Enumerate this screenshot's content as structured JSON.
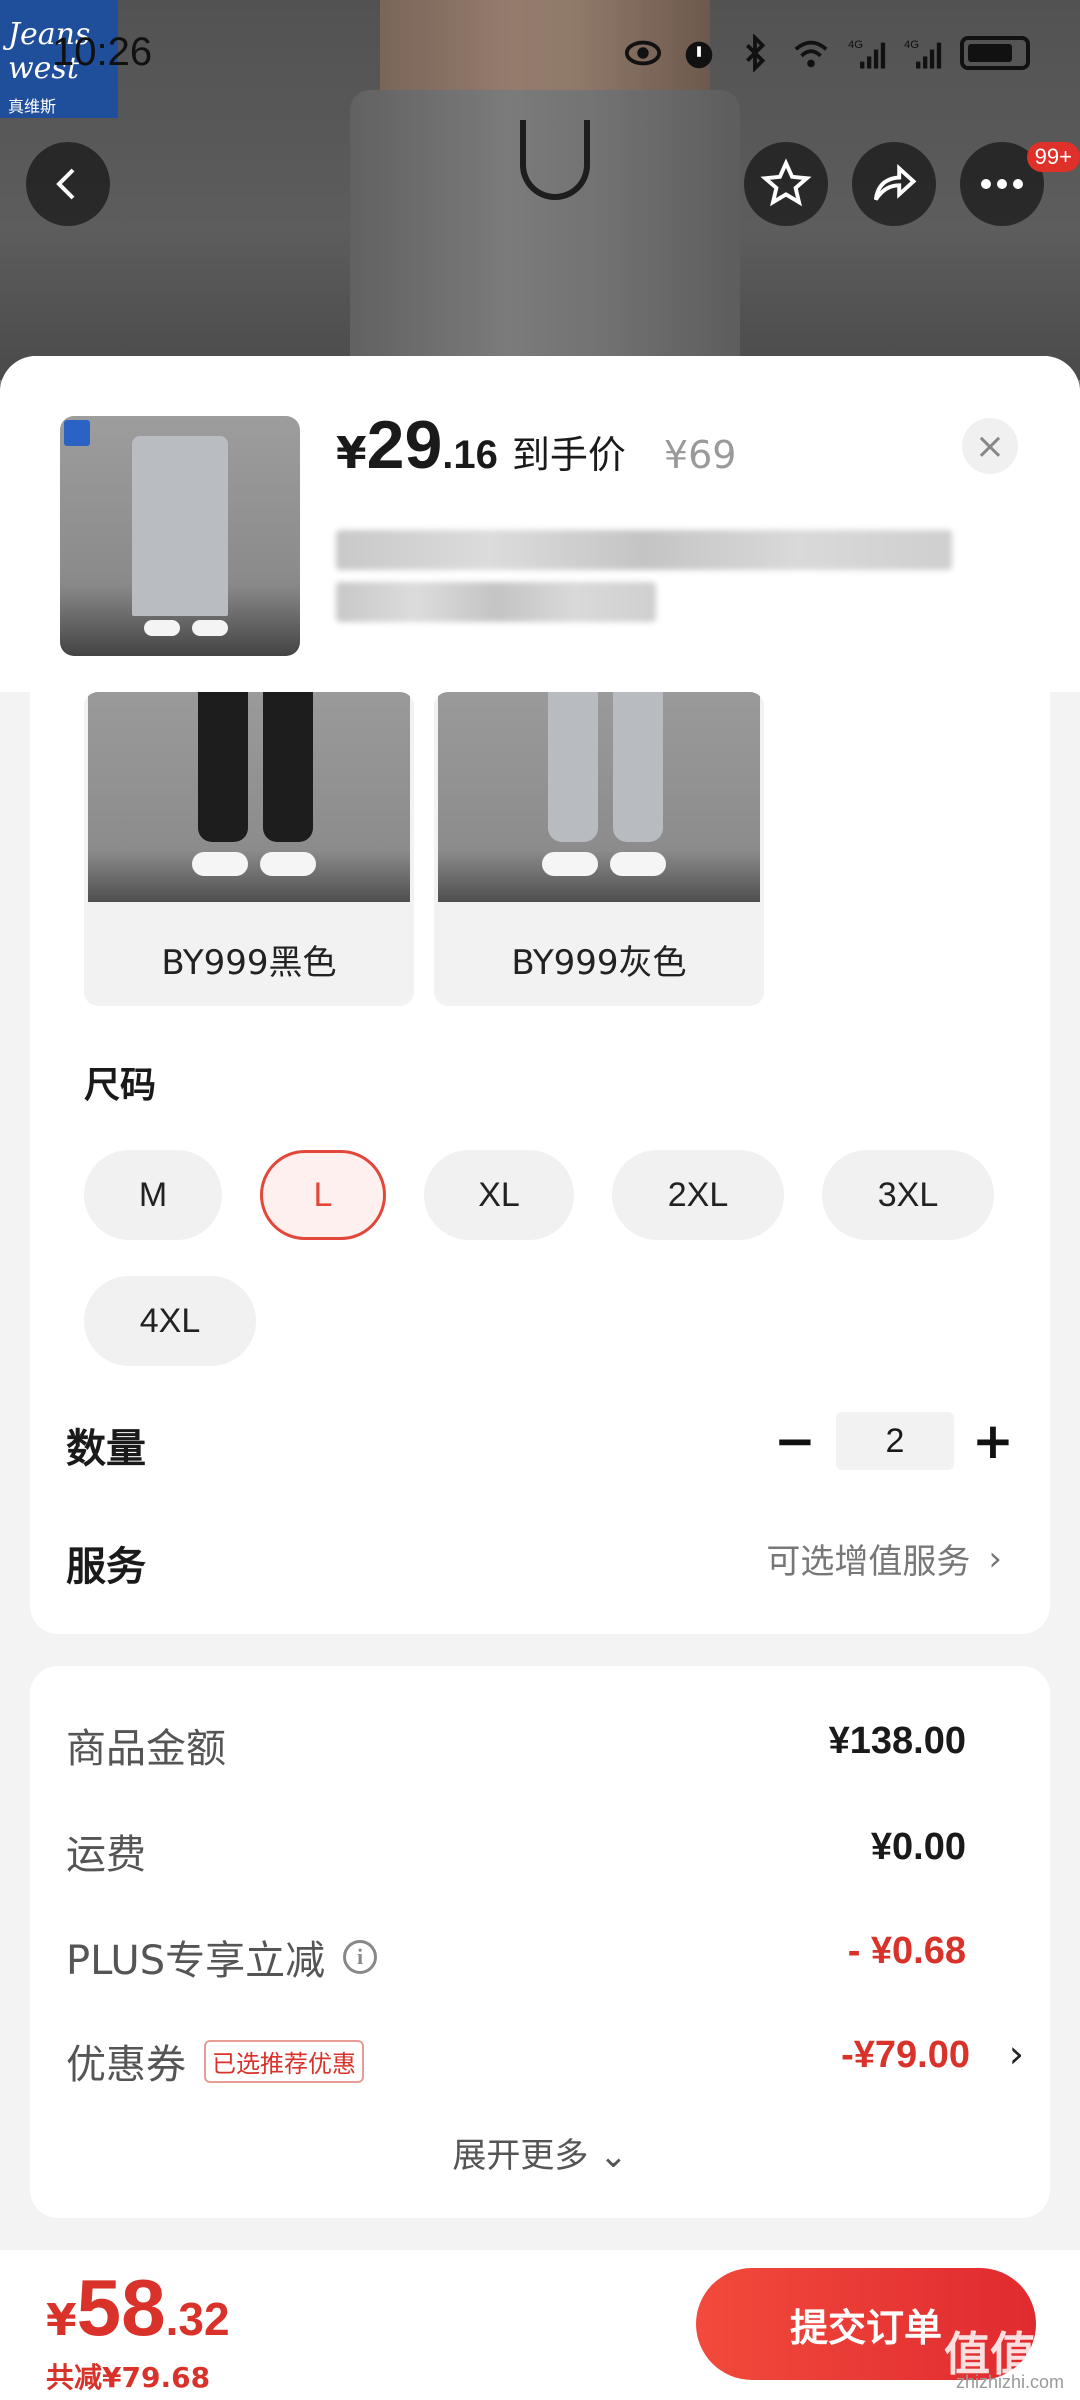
{
  "status": {
    "time": "10:26",
    "icons": [
      "eye-icon",
      "alarm-icon",
      "bluetooth-icon",
      "wifi-icon",
      "signal-4g-icon",
      "signal-4g-icon",
      "battery-icon"
    ]
  },
  "brand_logo": {
    "line1": "Jeans",
    "line2": "west",
    "cn": "真维斯"
  },
  "top_nav": {
    "notification_count": "99+"
  },
  "product": {
    "price_currency": "¥",
    "price_int": "29",
    "price_dec": ".16",
    "price_tag": "到手价",
    "original_price": "¥69",
    "close_glyph": "×"
  },
  "variants": [
    {
      "label": "BY999黑色",
      "pant_color": "#1d1d1d"
    },
    {
      "label": "BY999灰色",
      "pant_color": "#b8bcc0"
    }
  ],
  "size": {
    "title": "尺码",
    "options": [
      "M",
      "L",
      "XL",
      "2XL",
      "3XL",
      "4XL"
    ],
    "selected": "L"
  },
  "quantity": {
    "label": "数量",
    "value": "2",
    "minus": "−",
    "plus": "+"
  },
  "service": {
    "label": "服务",
    "hint": "可选增值服务",
    "chevron": "›"
  },
  "summary": {
    "goods_amount_label": "商品金额",
    "goods_amount": "¥138.00",
    "shipping_label": "运费",
    "shipping": "¥0.00",
    "plus_label": "PLUS专享立减",
    "plus_value": "- ¥0.68",
    "coupon_label": "优惠券",
    "coupon_tag": "已选推荐优惠",
    "coupon_value": "-¥79.00",
    "expand_more": "展开更多 ⌄"
  },
  "footer": {
    "total_currency": "¥",
    "total_int": "58",
    "total_dec": ".32",
    "saved": "共减¥79.68",
    "submit": "提交订单",
    "watermark": "值值值",
    "watermark_sub": "zhizhizhi.com"
  },
  "colors": {
    "accent": "#e0302a",
    "price_red": "#d8322a"
  }
}
